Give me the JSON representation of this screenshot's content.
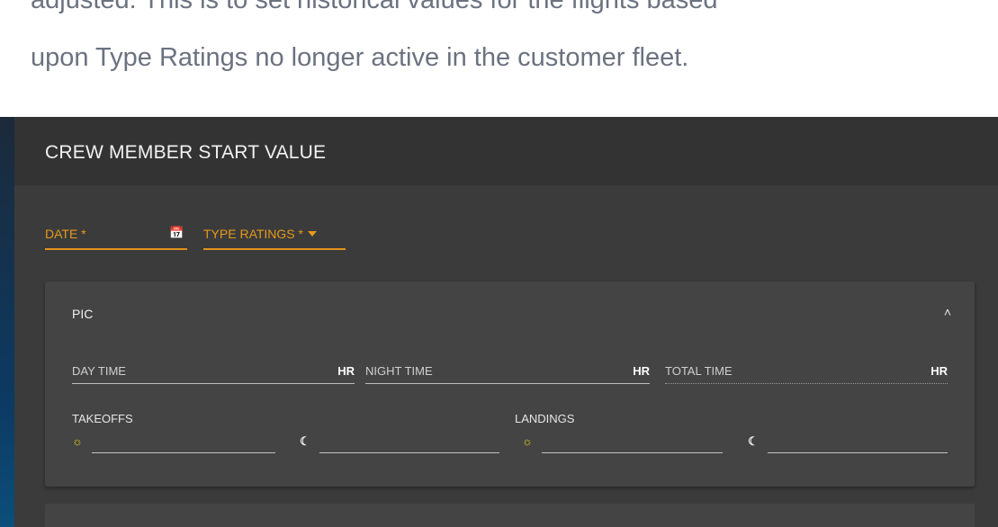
{
  "doc": {
    "line1": "adjusted. This is to set historical values for the flights based",
    "line2": "upon Type Ratings no longer active in the customer fleet."
  },
  "panel": {
    "title": "CREW MEMBER START VALUE",
    "date_label": "DATE *",
    "type_ratings_label": "TYPE RATINGS *"
  },
  "pic": {
    "title": "PIC",
    "day_time": "DAY TIME",
    "night_time": "NIGHT TIME",
    "total_time": "TOTAL TIME",
    "unit": "HR",
    "takeoffs": "TAKEOFFS",
    "landings": "LANDINGS"
  },
  "colors": {
    "accent": "#e59a1b",
    "panel_bg": "#3b3b3b",
    "card_bg": "#444444",
    "doc_text": "#6b7280"
  },
  "icons": {
    "calendar": "calendar-icon",
    "dropdown": "caret-down-icon",
    "collapse": "chevron-up-icon",
    "day": "sun-icon",
    "night": "moon-icon"
  }
}
